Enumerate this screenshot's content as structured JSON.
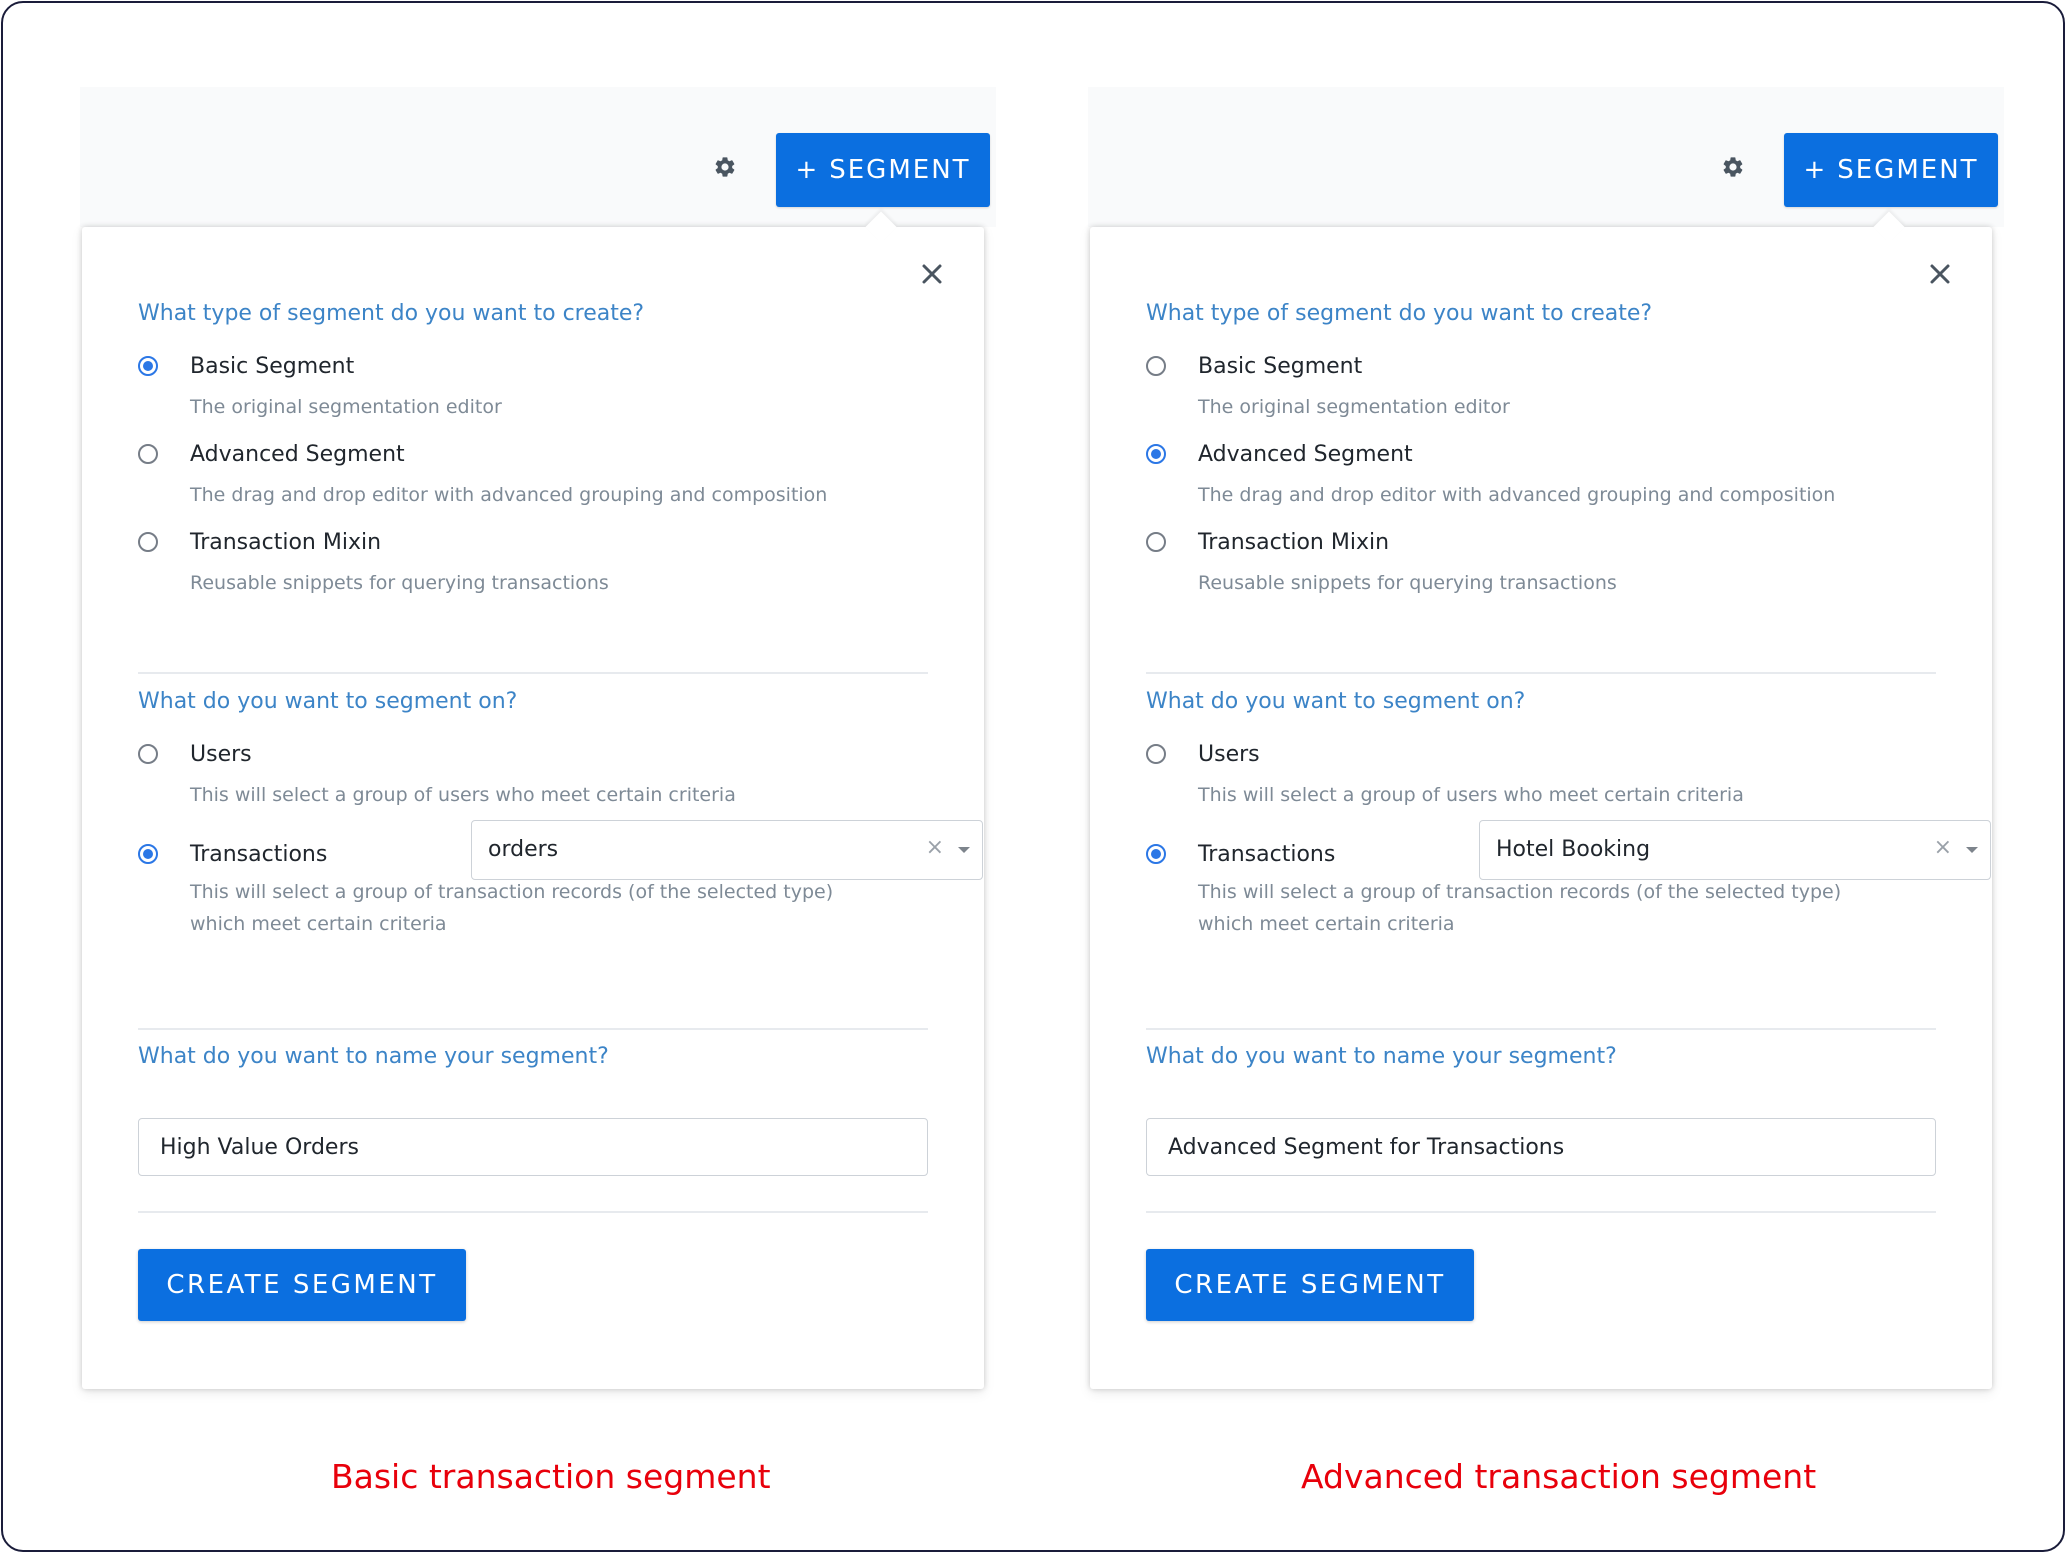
{
  "panels": [
    {
      "settings_icon": "gear-icon",
      "segment_button": {
        "plus": "+",
        "label": "SEGMENT"
      },
      "close_icon": "close-icon",
      "type_question": "What type of segment do you want to create?",
      "type_options": [
        {
          "label": "Basic Segment",
          "description": "The original segmentation editor",
          "checked": true
        },
        {
          "label": "Advanced Segment",
          "description": "The drag and drop editor with advanced grouping and composition",
          "checked": false
        },
        {
          "label": "Transaction Mixin",
          "description": "Reusable snippets for querying transactions",
          "checked": false
        }
      ],
      "on_question": "What do you want to segment on?",
      "on_options": [
        {
          "label": "Users",
          "description": "This will select a group of users who meet certain criteria",
          "checked": false
        },
        {
          "label": "Transactions",
          "description_line1": "This will select a group of transaction records (of the selected type)",
          "description_line2": "which meet certain criteria",
          "checked": true
        }
      ],
      "transaction_select": {
        "value": "orders",
        "clear": "×"
      },
      "name_question": "What do you want to name your segment?",
      "name_value": "High Value Orders",
      "create_button": "CREATE SEGMENT",
      "caption": "Basic transaction segment"
    },
    {
      "settings_icon": "gear-icon",
      "segment_button": {
        "plus": "+",
        "label": "SEGMENT"
      },
      "close_icon": "close-icon",
      "type_question": "What type of segment do you want to create?",
      "type_options": [
        {
          "label": "Basic Segment",
          "description": "The original segmentation editor",
          "checked": false
        },
        {
          "label": "Advanced Segment",
          "description": "The drag and drop editor with advanced grouping and composition",
          "checked": true
        },
        {
          "label": "Transaction Mixin",
          "description": "Reusable snippets for querying transactions",
          "checked": false
        }
      ],
      "on_question": "What do you want to segment on?",
      "on_options": [
        {
          "label": "Users",
          "description": "This will select a group of users who meet certain criteria",
          "checked": false
        },
        {
          "label": "Transactions",
          "description_line1": "This will select a group of transaction records (of the selected type)",
          "description_line2": "which meet certain criteria",
          "checked": true
        }
      ],
      "transaction_select": {
        "value": "Hotel Booking",
        "clear": "×"
      },
      "name_question": "What do you want to name your segment?",
      "name_value": "Advanced Segment for Transactions",
      "create_button": "CREATE SEGMENT",
      "caption": "Advanced transaction segment"
    }
  ],
  "colors": {
    "primary_button": "#0b6fe0",
    "question_text": "#3c84c7",
    "radio_checked": "#2b77e6",
    "caption_text": "#e8000b"
  }
}
